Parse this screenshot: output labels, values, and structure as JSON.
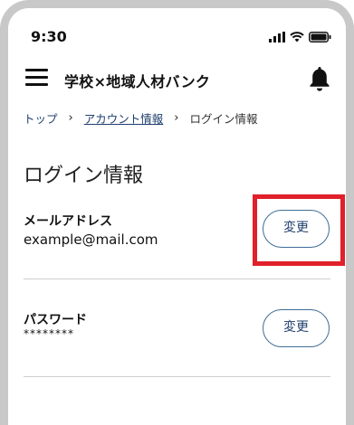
{
  "status_bar": {
    "time": "9:30",
    "icons": [
      "signal-icon",
      "wifi-icon",
      "battery-icon"
    ]
  },
  "header": {
    "menu_icon": "hamburger-menu-icon",
    "title": "学校×地域人材バンク",
    "notification_icon": "bell-icon"
  },
  "breadcrumb": {
    "items": [
      {
        "label": "トップ"
      },
      {
        "label": "アカウント情報"
      },
      {
        "label": "ログイン情報"
      }
    ],
    "separator": "›"
  },
  "page": {
    "title": "ログイン情報"
  },
  "email_section": {
    "label": "メールアドレス",
    "value": "example@mail.com",
    "change_label": "変更"
  },
  "password_section": {
    "label": "パスワード",
    "value": "********",
    "change_label": "変更"
  },
  "colors": {
    "accent": "#1f3f6e",
    "button_border": "#3f6e97",
    "highlight": "#e0202a",
    "frame": "#c8c8c8"
  }
}
